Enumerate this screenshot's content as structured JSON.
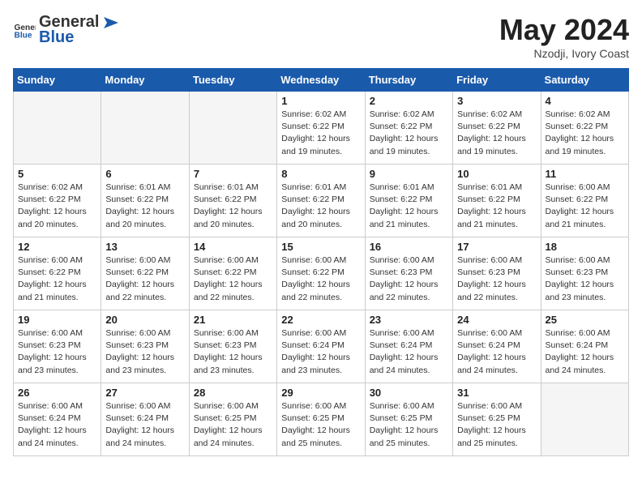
{
  "logo": {
    "general": "General",
    "blue": "Blue"
  },
  "header": {
    "month": "May 2024",
    "location": "Nzodji, Ivory Coast"
  },
  "weekdays": [
    "Sunday",
    "Monday",
    "Tuesday",
    "Wednesday",
    "Thursday",
    "Friday",
    "Saturday"
  ],
  "weeks": [
    [
      {
        "day": "",
        "info": "",
        "empty": true
      },
      {
        "day": "",
        "info": "",
        "empty": true
      },
      {
        "day": "",
        "info": "",
        "empty": true
      },
      {
        "day": "1",
        "info": "Sunrise: 6:02 AM\nSunset: 6:22 PM\nDaylight: 12 hours\nand 19 minutes."
      },
      {
        "day": "2",
        "info": "Sunrise: 6:02 AM\nSunset: 6:22 PM\nDaylight: 12 hours\nand 19 minutes."
      },
      {
        "day": "3",
        "info": "Sunrise: 6:02 AM\nSunset: 6:22 PM\nDaylight: 12 hours\nand 19 minutes."
      },
      {
        "day": "4",
        "info": "Sunrise: 6:02 AM\nSunset: 6:22 PM\nDaylight: 12 hours\nand 19 minutes."
      }
    ],
    [
      {
        "day": "5",
        "info": "Sunrise: 6:02 AM\nSunset: 6:22 PM\nDaylight: 12 hours\nand 20 minutes."
      },
      {
        "day": "6",
        "info": "Sunrise: 6:01 AM\nSunset: 6:22 PM\nDaylight: 12 hours\nand 20 minutes."
      },
      {
        "day": "7",
        "info": "Sunrise: 6:01 AM\nSunset: 6:22 PM\nDaylight: 12 hours\nand 20 minutes."
      },
      {
        "day": "8",
        "info": "Sunrise: 6:01 AM\nSunset: 6:22 PM\nDaylight: 12 hours\nand 20 minutes."
      },
      {
        "day": "9",
        "info": "Sunrise: 6:01 AM\nSunset: 6:22 PM\nDaylight: 12 hours\nand 21 minutes."
      },
      {
        "day": "10",
        "info": "Sunrise: 6:01 AM\nSunset: 6:22 PM\nDaylight: 12 hours\nand 21 minutes."
      },
      {
        "day": "11",
        "info": "Sunrise: 6:00 AM\nSunset: 6:22 PM\nDaylight: 12 hours\nand 21 minutes."
      }
    ],
    [
      {
        "day": "12",
        "info": "Sunrise: 6:00 AM\nSunset: 6:22 PM\nDaylight: 12 hours\nand 21 minutes."
      },
      {
        "day": "13",
        "info": "Sunrise: 6:00 AM\nSunset: 6:22 PM\nDaylight: 12 hours\nand 22 minutes."
      },
      {
        "day": "14",
        "info": "Sunrise: 6:00 AM\nSunset: 6:22 PM\nDaylight: 12 hours\nand 22 minutes."
      },
      {
        "day": "15",
        "info": "Sunrise: 6:00 AM\nSunset: 6:22 PM\nDaylight: 12 hours\nand 22 minutes."
      },
      {
        "day": "16",
        "info": "Sunrise: 6:00 AM\nSunset: 6:23 PM\nDaylight: 12 hours\nand 22 minutes."
      },
      {
        "day": "17",
        "info": "Sunrise: 6:00 AM\nSunset: 6:23 PM\nDaylight: 12 hours\nand 22 minutes."
      },
      {
        "day": "18",
        "info": "Sunrise: 6:00 AM\nSunset: 6:23 PM\nDaylight: 12 hours\nand 23 minutes."
      }
    ],
    [
      {
        "day": "19",
        "info": "Sunrise: 6:00 AM\nSunset: 6:23 PM\nDaylight: 12 hours\nand 23 minutes."
      },
      {
        "day": "20",
        "info": "Sunrise: 6:00 AM\nSunset: 6:23 PM\nDaylight: 12 hours\nand 23 minutes."
      },
      {
        "day": "21",
        "info": "Sunrise: 6:00 AM\nSunset: 6:23 PM\nDaylight: 12 hours\nand 23 minutes."
      },
      {
        "day": "22",
        "info": "Sunrise: 6:00 AM\nSunset: 6:24 PM\nDaylight: 12 hours\nand 23 minutes."
      },
      {
        "day": "23",
        "info": "Sunrise: 6:00 AM\nSunset: 6:24 PM\nDaylight: 12 hours\nand 24 minutes."
      },
      {
        "day": "24",
        "info": "Sunrise: 6:00 AM\nSunset: 6:24 PM\nDaylight: 12 hours\nand 24 minutes."
      },
      {
        "day": "25",
        "info": "Sunrise: 6:00 AM\nSunset: 6:24 PM\nDaylight: 12 hours\nand 24 minutes."
      }
    ],
    [
      {
        "day": "26",
        "info": "Sunrise: 6:00 AM\nSunset: 6:24 PM\nDaylight: 12 hours\nand 24 minutes."
      },
      {
        "day": "27",
        "info": "Sunrise: 6:00 AM\nSunset: 6:24 PM\nDaylight: 12 hours\nand 24 minutes."
      },
      {
        "day": "28",
        "info": "Sunrise: 6:00 AM\nSunset: 6:25 PM\nDaylight: 12 hours\nand 24 minutes."
      },
      {
        "day": "29",
        "info": "Sunrise: 6:00 AM\nSunset: 6:25 PM\nDaylight: 12 hours\nand 25 minutes."
      },
      {
        "day": "30",
        "info": "Sunrise: 6:00 AM\nSunset: 6:25 PM\nDaylight: 12 hours\nand 25 minutes."
      },
      {
        "day": "31",
        "info": "Sunrise: 6:00 AM\nSunset: 6:25 PM\nDaylight: 12 hours\nand 25 minutes."
      },
      {
        "day": "",
        "info": "",
        "empty": true
      }
    ]
  ]
}
